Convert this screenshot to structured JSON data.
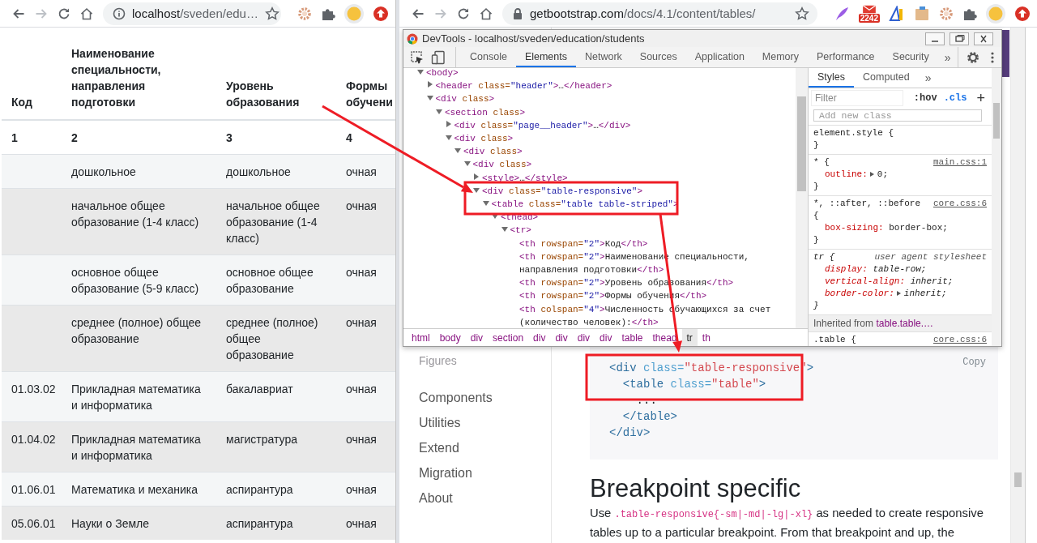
{
  "left_browser": {
    "security": {
      "kind": "info"
    },
    "url_host": "localhost",
    "url_path": "/sveden/edu…",
    "forward_disabled": true,
    "extensions": [
      {
        "kind": "gear"
      },
      {
        "kind": "puzzle"
      },
      {
        "kind": "avatar"
      },
      {
        "kind": "upload"
      }
    ]
  },
  "students_table": {
    "columns": [
      "Код",
      "Наименование специальности, направления подготовки",
      "Уровень образования",
      "Формы обучени"
    ],
    "numbers": [
      "1",
      "2",
      "3",
      "4"
    ],
    "rows": [
      {
        "name": "дошкольное",
        "level": "дошкольное",
        "form": "очная"
      },
      {
        "name": "начальное общее образование (1-4 класс)",
        "level": "начальное общее образование (1-4 класс)",
        "form": "очная"
      },
      {
        "name": "основное общее образование (5-9 класс)",
        "level": "основное общее образование",
        "form": "очная"
      },
      {
        "name": "среднее (полное) общее образование",
        "level": "среднее (полное) общее образование",
        "form": "очная"
      },
      {
        "code": "01.03.02",
        "name": "Прикладная математика и информатика",
        "level": "бакалавриат",
        "form": "очная"
      },
      {
        "code": "01.04.02",
        "name": "Прикладная математика и информатика",
        "level": "магистратура",
        "form": "очная"
      },
      {
        "code": "01.06.01",
        "name": "Математика и механика",
        "level": "аспирантура",
        "form": "очная"
      },
      {
        "code": "05.06.01",
        "name": "Науки о Земле",
        "level": "аспирантура",
        "form": "очная"
      }
    ]
  },
  "right_browser": {
    "security": {
      "kind": "lock"
    },
    "url_host": "getbootstrap.com",
    "url_path": "/docs/4.1/content/tables/",
    "forward_disabled": true,
    "extensions": [
      {
        "kind": "quill"
      },
      {
        "kind": "mail",
        "badge": "2242"
      },
      {
        "kind": "ruler"
      },
      {
        "kind": "box"
      },
      {
        "kind": "gear"
      },
      {
        "kind": "puzzle"
      },
      {
        "kind": "avatar"
      },
      {
        "kind": "upload"
      }
    ]
  },
  "docs_page": {
    "sidebar": [
      {
        "label": "Figures",
        "kind": "sublink"
      },
      {
        "label": "Components",
        "kind": "section"
      },
      {
        "label": "Utilities",
        "kind": "section"
      },
      {
        "label": "Extend",
        "kind": "section"
      },
      {
        "label": "Migration",
        "kind": "section"
      },
      {
        "label": "About",
        "kind": "section"
      }
    ],
    "copy": "Copy",
    "code_lines": [
      [
        {
          "kind": "tag",
          "text": "<div"
        },
        {
          "kind": "attr",
          "text": " class="
        },
        {
          "kind": "value",
          "text": "\"table-responsive\""
        },
        {
          "kind": "tag",
          "text": ">"
        }
      ],
      [
        {
          "kind": "tag",
          "text": "  <table"
        },
        {
          "kind": "attr",
          "text": " class="
        },
        {
          "kind": "value",
          "text": "\"table\""
        },
        {
          "kind": "tag",
          "text": ">"
        }
      ],
      [
        {
          "kind": "text",
          "text": "    ..."
        }
      ],
      [
        {
          "kind": "tag",
          "text": "  </table>"
        }
      ],
      [
        {
          "kind": "tag",
          "text": "</div>"
        }
      ]
    ],
    "heading": "Breakpoint specific",
    "paragraph": [
      {
        "kind": "text",
        "text": "Use "
      },
      {
        "kind": "code",
        "text": ".table-responsive{-sm|-md|-lg|-xl}"
      },
      {
        "kind": "text",
        "text": " as needed to create responsive tables up to a particular breakpoint. From that breakpoint and up, the"
      }
    ]
  },
  "devtools": {
    "title": "DevTools - localhost/sveden/education/students",
    "tabs": [
      {
        "label": "Console",
        "selected": false
      },
      {
        "label": "Elements",
        "selected": true
      },
      {
        "label": "Network",
        "selected": false
      },
      {
        "label": "Sources",
        "selected": false
      },
      {
        "label": "Application",
        "selected": false
      },
      {
        "label": "Memory",
        "selected": false
      },
      {
        "label": "Performance",
        "selected": false
      },
      {
        "label": "Security",
        "selected": false
      }
    ],
    "more_tabs": "»",
    "tree": [
      {
        "kind": "element",
        "expanded": true,
        "parts": [
          {
            "kind": "tag",
            "text": "<body>"
          }
        ],
        "children": [
          {
            "kind": "element",
            "expanded": false,
            "parts": [
              {
                "kind": "tag",
                "text": "<header"
              },
              {
                "kind": "attr",
                "text": " class="
              },
              {
                "kind": "value",
                "text": "\"header\""
              },
              {
                "kind": "tag",
                "text": ">"
              },
              {
                "kind": "text",
                "text": "…"
              },
              {
                "kind": "tag",
                "text": "</header>"
              }
            ]
          },
          {
            "kind": "element",
            "expanded": true,
            "parts": [
              {
                "kind": "tag",
                "text": "<div"
              },
              {
                "kind": "attr",
                "text": " class"
              },
              {
                "kind": "tag",
                "text": ">"
              }
            ],
            "children": [
              {
                "kind": "element",
                "expanded": true,
                "parts": [
                  {
                    "kind": "tag",
                    "text": "<section"
                  },
                  {
                    "kind": "attr",
                    "text": " class"
                  },
                  {
                    "kind": "tag",
                    "text": ">"
                  }
                ],
                "children": [
                  {
                    "kind": "element",
                    "expanded": false,
                    "parts": [
                      {
                        "kind": "tag",
                        "text": "<div"
                      },
                      {
                        "kind": "attr",
                        "text": " class="
                      },
                      {
                        "kind": "value",
                        "text": "\"page__header\""
                      },
                      {
                        "kind": "tag",
                        "text": ">"
                      },
                      {
                        "kind": "text",
                        "text": "…"
                      },
                      {
                        "kind": "tag",
                        "text": "</div>"
                      }
                    ]
                  },
                  {
                    "kind": "element",
                    "expanded": true,
                    "parts": [
                      {
                        "kind": "tag",
                        "text": "<div"
                      },
                      {
                        "kind": "attr",
                        "text": " class"
                      },
                      {
                        "kind": "tag",
                        "text": ">"
                      }
                    ],
                    "children": [
                      {
                        "kind": "element",
                        "expanded": true,
                        "parts": [
                          {
                            "kind": "tag",
                            "text": "<div"
                          },
                          {
                            "kind": "attr",
                            "text": " class"
                          },
                          {
                            "kind": "tag",
                            "text": ">"
                          }
                        ],
                        "children": [
                          {
                            "kind": "element",
                            "expanded": true,
                            "parts": [
                              {
                                "kind": "tag",
                                "text": "<div"
                              },
                              {
                                "kind": "attr",
                                "text": " class"
                              },
                              {
                                "kind": "tag",
                                "text": ">"
                              }
                            ],
                            "children": [
                              {
                                "kind": "element",
                                "expanded": false,
                                "parts": [
                                  {
                                    "kind": "tag",
                                    "text": "<style>"
                                  },
                                  {
                                    "kind": "text",
                                    "text": "…"
                                  },
                                  {
                                    "kind": "tag",
                                    "text": "</style>"
                                  }
                                ]
                              },
                              {
                                "kind": "element",
                                "expanded": true,
                                "parts": [
                                  {
                                    "kind": "tag",
                                    "text": "<div"
                                  },
                                  {
                                    "kind": "attr",
                                    "text": " class="
                                  },
                                  {
                                    "kind": "value",
                                    "text": "\"table-responsive\""
                                  },
                                  {
                                    "kind": "tag",
                                    "text": ">"
                                  }
                                ],
                                "children": [
                                  {
                                    "kind": "element",
                                    "expanded": true,
                                    "parts": [
                                      {
                                        "kind": "tag",
                                        "text": "<table"
                                      },
                                      {
                                        "kind": "attr",
                                        "text": " class="
                                      },
                                      {
                                        "kind": "value",
                                        "text": "\"table table-striped\""
                                      },
                                      {
                                        "kind": "tag",
                                        "text": ">"
                                      }
                                    ],
                                    "children": [
                                      {
                                        "kind": "element",
                                        "expanded": true,
                                        "parts": [
                                          {
                                            "kind": "tag",
                                            "text": "<thead>"
                                          }
                                        ],
                                        "children": [
                                          {
                                            "kind": "element",
                                            "expanded": true,
                                            "parts": [
                                              {
                                                "kind": "tag",
                                                "text": "<tr>"
                                              }
                                            ],
                                            "children": [
                                              {
                                                "kind": "leaf",
                                                "parts": [
                                                  {
                                                    "kind": "tag",
                                                    "text": "<th"
                                                  },
                                                  {
                                                    "kind": "attr",
                                                    "text": " rowspan="
                                                  },
                                                  {
                                                    "kind": "value",
                                                    "text": "\"2\""
                                                  },
                                                  {
                                                    "kind": "tag",
                                                    "text": ">"
                                                  },
                                                  {
                                                    "kind": "text",
                                                    "text": "Код"
                                                  },
                                                  {
                                                    "kind": "tag",
                                                    "text": "</th>"
                                                  }
                                                ]
                                              },
                                              {
                                                "kind": "leaf",
                                                "parts": [
                                                  {
                                                    "kind": "tag",
                                                    "text": "<th"
                                                  },
                                                  {
                                                    "kind": "attr",
                                                    "text": " rowspan="
                                                  },
                                                  {
                                                    "kind": "value",
                                                    "text": "\"2\""
                                                  },
                                                  {
                                                    "kind": "tag",
                                                    "text": ">"
                                                  },
                                                  {
                                                    "kind": "text",
                                                    "text": "Наименование специальности, направления подготовки"
                                                  },
                                                  {
                                                    "kind": "tag",
                                                    "text": "</th>"
                                                  }
                                                ]
                                              },
                                              {
                                                "kind": "leaf",
                                                "parts": [
                                                  {
                                                    "kind": "tag",
                                                    "text": "<th"
                                                  },
                                                  {
                                                    "kind": "attr",
                                                    "text": " rowspan="
                                                  },
                                                  {
                                                    "kind": "value",
                                                    "text": "\"2\""
                                                  },
                                                  {
                                                    "kind": "tag",
                                                    "text": ">"
                                                  },
                                                  {
                                                    "kind": "text",
                                                    "text": "Уровень образования"
                                                  },
                                                  {
                                                    "kind": "tag",
                                                    "text": "</th>"
                                                  }
                                                ]
                                              },
                                              {
                                                "kind": "leaf",
                                                "parts": [
                                                  {
                                                    "kind": "tag",
                                                    "text": "<th"
                                                  },
                                                  {
                                                    "kind": "attr",
                                                    "text": " rowspan="
                                                  },
                                                  {
                                                    "kind": "value",
                                                    "text": "\"2\""
                                                  },
                                                  {
                                                    "kind": "tag",
                                                    "text": ">"
                                                  },
                                                  {
                                                    "kind": "text",
                                                    "text": "Формы обучения"
                                                  },
                                                  {
                                                    "kind": "tag",
                                                    "text": "</th>"
                                                  }
                                                ]
                                              },
                                              {
                                                "kind": "leaf",
                                                "parts": [
                                                  {
                                                    "kind": "tag",
                                                    "text": "<th"
                                                  },
                                                  {
                                                    "kind": "attr",
                                                    "text": " colspan="
                                                  },
                                                  {
                                                    "kind": "value",
                                                    "text": "\"4\""
                                                  },
                                                  {
                                                    "kind": "tag",
                                                    "text": ">"
                                                  },
                                                  {
                                                    "kind": "text",
                                                    "text": "Численность обучающихся за счет (количество человек):"
                                                  },
                                                  {
                                                    "kind": "tag",
                                                    "text": "</th>"
                                                  }
                                                ]
                                              }
                                            ]
                                          }
                                        ]
                                      }
                                    ]
                                  }
                                ]
                              }
                            ]
                          }
                        ]
                      }
                    ]
                  }
                ]
              }
            ]
          }
        ]
      }
    ],
    "breadcrumb": [
      {
        "label": "html",
        "selected": false
      },
      {
        "label": "body",
        "selected": false
      },
      {
        "label": "div",
        "selected": false
      },
      {
        "label": "section",
        "selected": false
      },
      {
        "label": "div",
        "selected": false
      },
      {
        "label": "div",
        "selected": false
      },
      {
        "label": "div",
        "selected": false
      },
      {
        "label": "div",
        "selected": false
      },
      {
        "label": "table",
        "selected": false
      },
      {
        "label": "thead",
        "selected": false
      },
      {
        "label": "tr",
        "selected": true
      },
      {
        "label": "th",
        "selected": false
      }
    ],
    "styles_tabs": [
      {
        "label": "Styles",
        "selected": true
      },
      {
        "label": "Computed",
        "selected": false
      }
    ],
    "styles_more": "»",
    "filter_placeholder": "Filter",
    "hov": ":hov",
    "cls": ".cls",
    "add": "+",
    "class_placeholder": "Add new class",
    "rules": [
      {
        "kind": "author_rule",
        "selector": "element.style {",
        "close": "}"
      },
      {
        "kind": "author_rule",
        "selector": "* {",
        "source": "main.css:1",
        "declarations": [
          {
            "property": "outline:",
            "value": "0;",
            "expandable": true
          }
        ],
        "close": "}"
      },
      {
        "kind": "author_rule",
        "selector": "*, ::after, ::before {",
        "source": "core.css:6",
        "declarations": [
          {
            "property": "box-sizing:",
            "value": "border-box;",
            "expandable": false
          }
        ],
        "close": "}"
      },
      {
        "kind": "ua_rule",
        "selector": "tr {",
        "source": "user agent stylesheet",
        "declarations": [
          {
            "property": "display:",
            "value": "table-row;",
            "expandable": false
          },
          {
            "property": "vertical-align:",
            "value": "inherit;",
            "expandable": false
          },
          {
            "property": "border-color:",
            "value": "inherit;",
            "expandable": true
          }
        ],
        "close": "}"
      },
      {
        "kind": "inherited",
        "label": "Inherited from",
        "element": "table.table.…"
      },
      {
        "kind": "author_rule",
        "selector": ".table {",
        "source": "core.css:6"
      }
    ]
  }
}
